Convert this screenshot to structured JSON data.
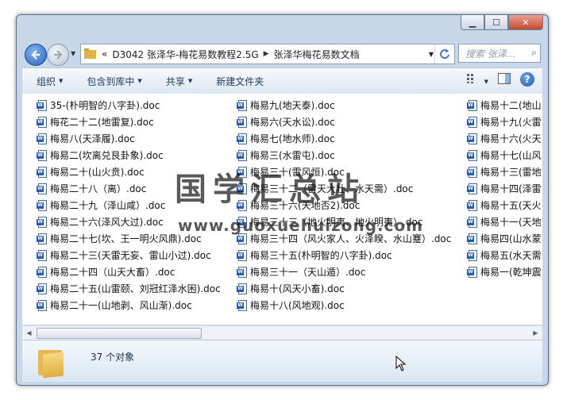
{
  "window": {
    "controls": {
      "minimize": "▁",
      "maximize": "☐",
      "close": "✕"
    }
  },
  "nav": {
    "back_icon": "arrow-left-icon",
    "forward_icon": "arrow-right-icon",
    "address_prefix": "«",
    "breadcrumbs": [
      "D3042  张泽华-梅花易数教程2.5G",
      "张泽华梅花易数文档"
    ],
    "search_placeholder": "搜索 张泽..."
  },
  "toolbar": {
    "organize": "组织",
    "include_library": "包含到库中",
    "share": "共享",
    "new_folder": "新建文件夹"
  },
  "files": {
    "col1": [
      "35-(朴明智的八字卦).doc",
      "梅花二十二(地雷复).doc",
      "梅易八(天泽履).doc",
      "梅易二(坎离兑艮卦象).doc",
      "梅易二十(山火贲).doc",
      "梅易二十八（离）.doc",
      "梅易二十九（泽山咸）.doc",
      "梅易二十六(泽风大过).doc",
      "梅易二十七(坎、王一明火风鼎).doc",
      "梅易二十三(天雷无妄、雷山小过).doc",
      "梅易二十四（山天大畜）.doc",
      "梅易二十五(山雷颐、刘冠红泽水困).doc",
      "梅易二十一(山地剥、风山渐).doc"
    ],
    "col2": [
      "梅易九(地天泰).doc",
      "梅易六(天水讼).doc",
      "梅易七(地水师).doc",
      "梅易三(水雷屯).doc",
      "梅易三十(雷风恒).doc",
      "梅易三十二（雷天大壮、水天需）.doc",
      "梅易三十六(天地否2).doc",
      "梅易三十三（地火明夷、地火明夷）.doc",
      "梅易三十四（风火家人、火泽睽、水山蹇）.doc",
      "梅易三十五(朴明智的八字卦).doc",
      "梅易三十一（天山遁）.doc",
      "梅易十(风天小畜).doc",
      "梅易十八(风地观).doc"
    ],
    "col3": [
      "梅易十二(地山",
      "梅易十九(火雷",
      "梅易十六(火天",
      "梅易十七(山风",
      "梅易十三(雷地",
      "梅易十四(泽雷",
      "梅易十五(天火",
      "梅易十一(天地",
      "梅易四(山水蒙",
      "梅易五(水天需",
      "梅易一(乾坤震"
    ]
  },
  "watermark": {
    "line1": "国学汇总站",
    "line2": "www.guoxuehuizong.com"
  },
  "status": {
    "count": "37 个对象"
  }
}
